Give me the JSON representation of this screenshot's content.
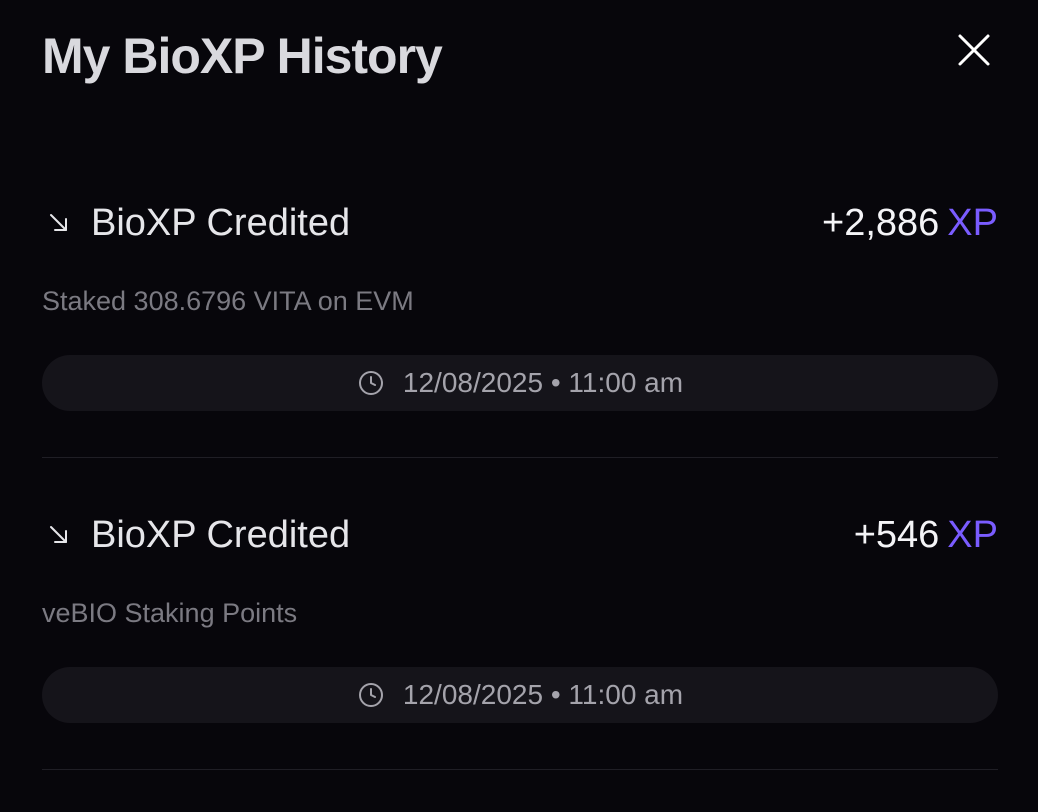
{
  "header": {
    "title": "My BioXP History"
  },
  "icons": {
    "close": "close-icon",
    "arrow": "arrow-down-right-icon",
    "clock": "clock-icon"
  },
  "colors": {
    "background": "#07060b",
    "accent": "#7a5cff"
  },
  "history": [
    {
      "title": "BioXP Credited",
      "amount": "+2,886",
      "unit": "XP",
      "description": "Staked 308.6796 VITA on EVM",
      "timestamp": "12/08/2025 • 11:00 am"
    },
    {
      "title": "BioXP Credited",
      "amount": "+546",
      "unit": "XP",
      "description": "veBIO Staking Points",
      "timestamp": "12/08/2025 • 11:00 am"
    }
  ]
}
